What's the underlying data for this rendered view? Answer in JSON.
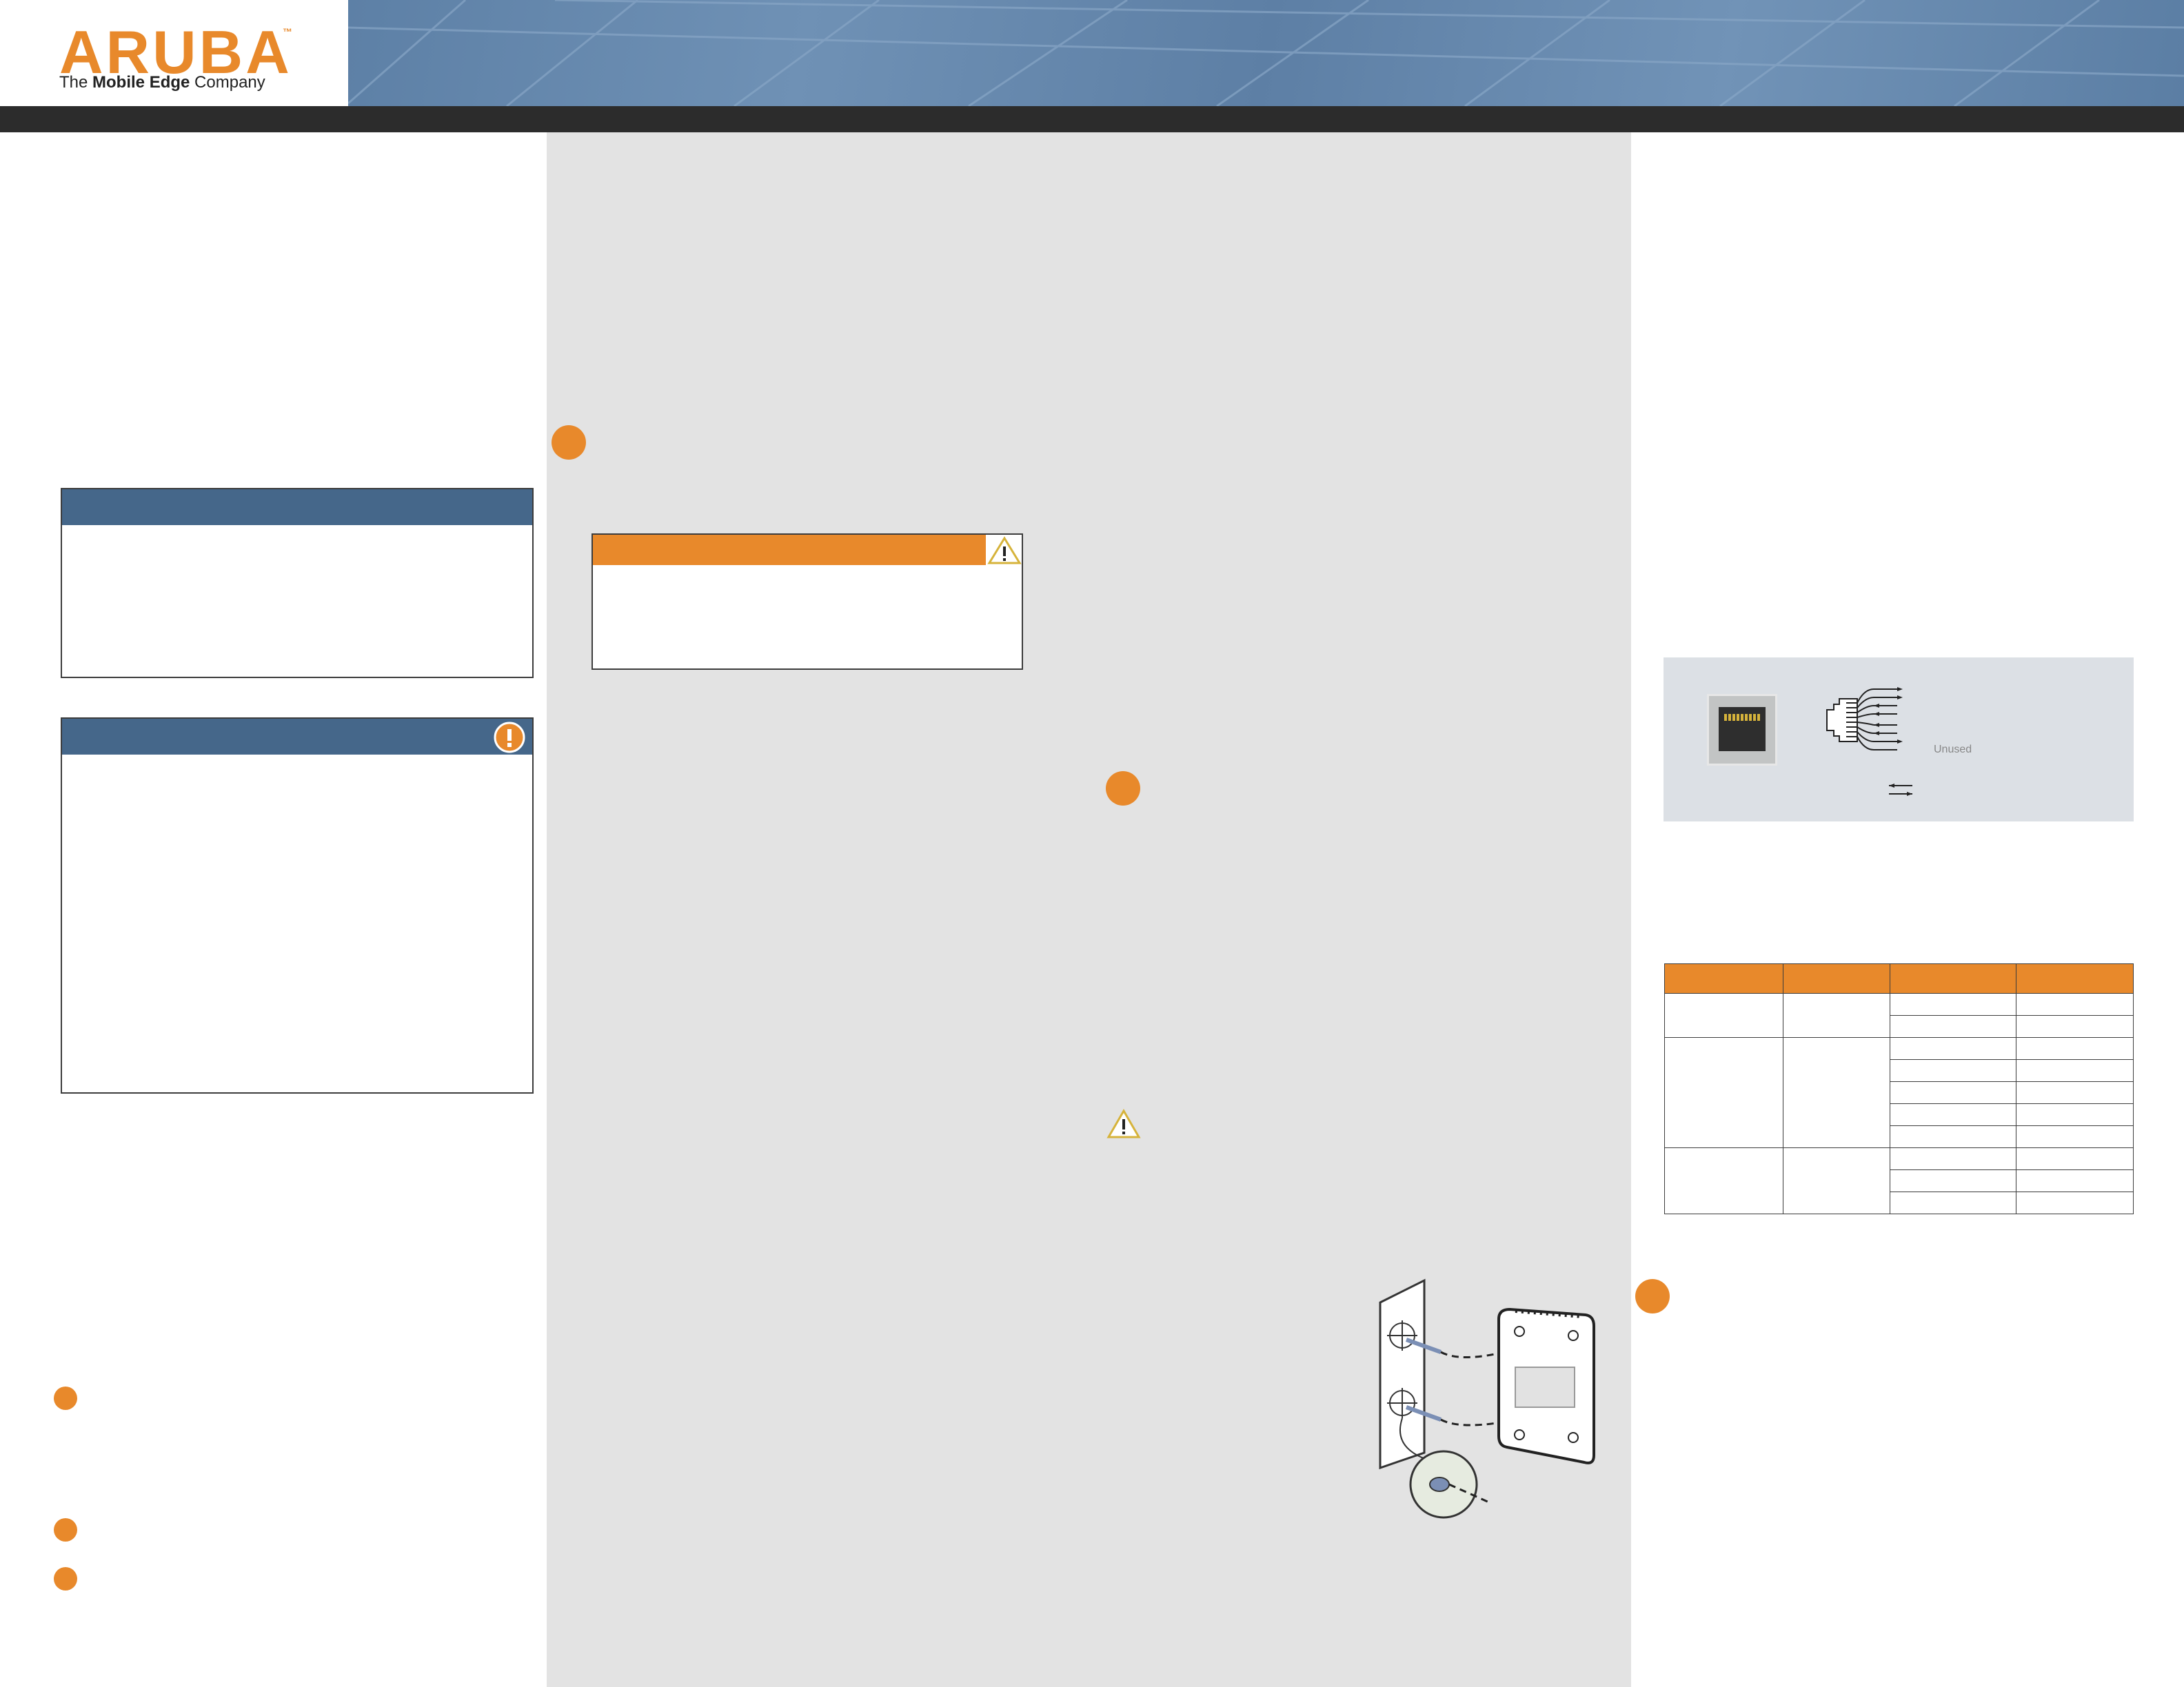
{
  "brand": {
    "logo_word": "ARUBA",
    "trademark": "™",
    "tagline_pre": "The ",
    "tagline_bold": "Mobile Edge",
    "tagline_post": " Company",
    "accent_color": "#e8892b",
    "header_blue": "#45678a",
    "panel_gray": "#e3e3e3"
  },
  "icons": {
    "caution": "exclamation-circle-icon",
    "warning": "warning-triangle-icon",
    "step": "step-bullet"
  },
  "connector": {
    "label": "Unused"
  }
}
